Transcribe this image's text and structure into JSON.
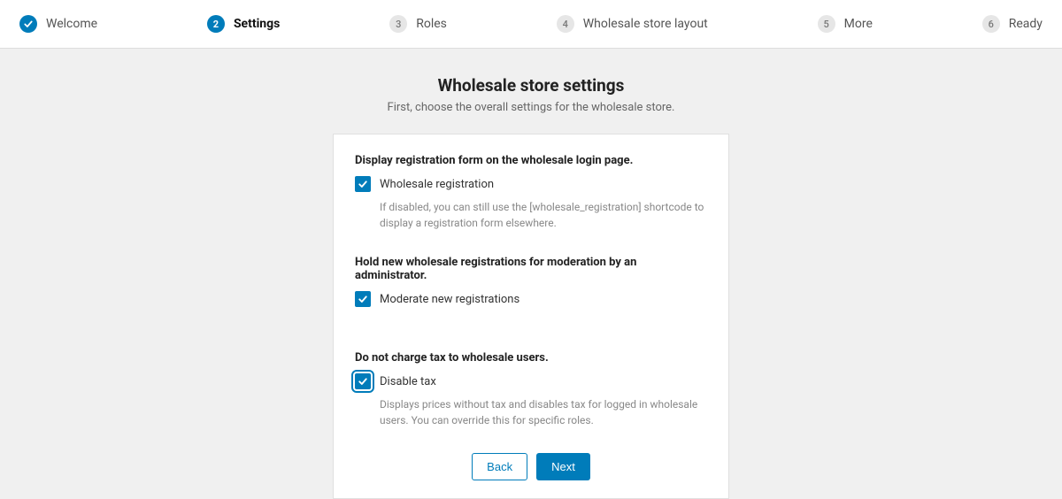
{
  "stepper": {
    "steps": [
      {
        "num": "1",
        "label": "Welcome",
        "state": "done"
      },
      {
        "num": "2",
        "label": "Settings",
        "state": "active"
      },
      {
        "num": "3",
        "label": "Roles",
        "state": ""
      },
      {
        "num": "4",
        "label": "Wholesale store layout",
        "state": ""
      },
      {
        "num": "5",
        "label": "More",
        "state": ""
      },
      {
        "num": "6",
        "label": "Ready",
        "state": ""
      }
    ]
  },
  "heading": {
    "title": "Wholesale store settings",
    "subtitle": "First, choose the overall settings for the wholesale store."
  },
  "sections": {
    "registration": {
      "title": "Display registration form on the wholesale login page.",
      "checkbox_label": "Wholesale registration",
      "hint": "If disabled, you can still use the [wholesale_registration] shortcode to display a registration form elsewhere."
    },
    "moderation": {
      "title": "Hold new wholesale registrations for moderation by an administrator.",
      "checkbox_label": "Moderate new registrations"
    },
    "tax": {
      "title": "Do not charge tax to wholesale users.",
      "checkbox_label": "Disable tax",
      "hint": "Displays prices without tax and disables tax for logged in wholesale users. You can override this for specific roles."
    }
  },
  "buttons": {
    "back": "Back",
    "next": "Next"
  }
}
